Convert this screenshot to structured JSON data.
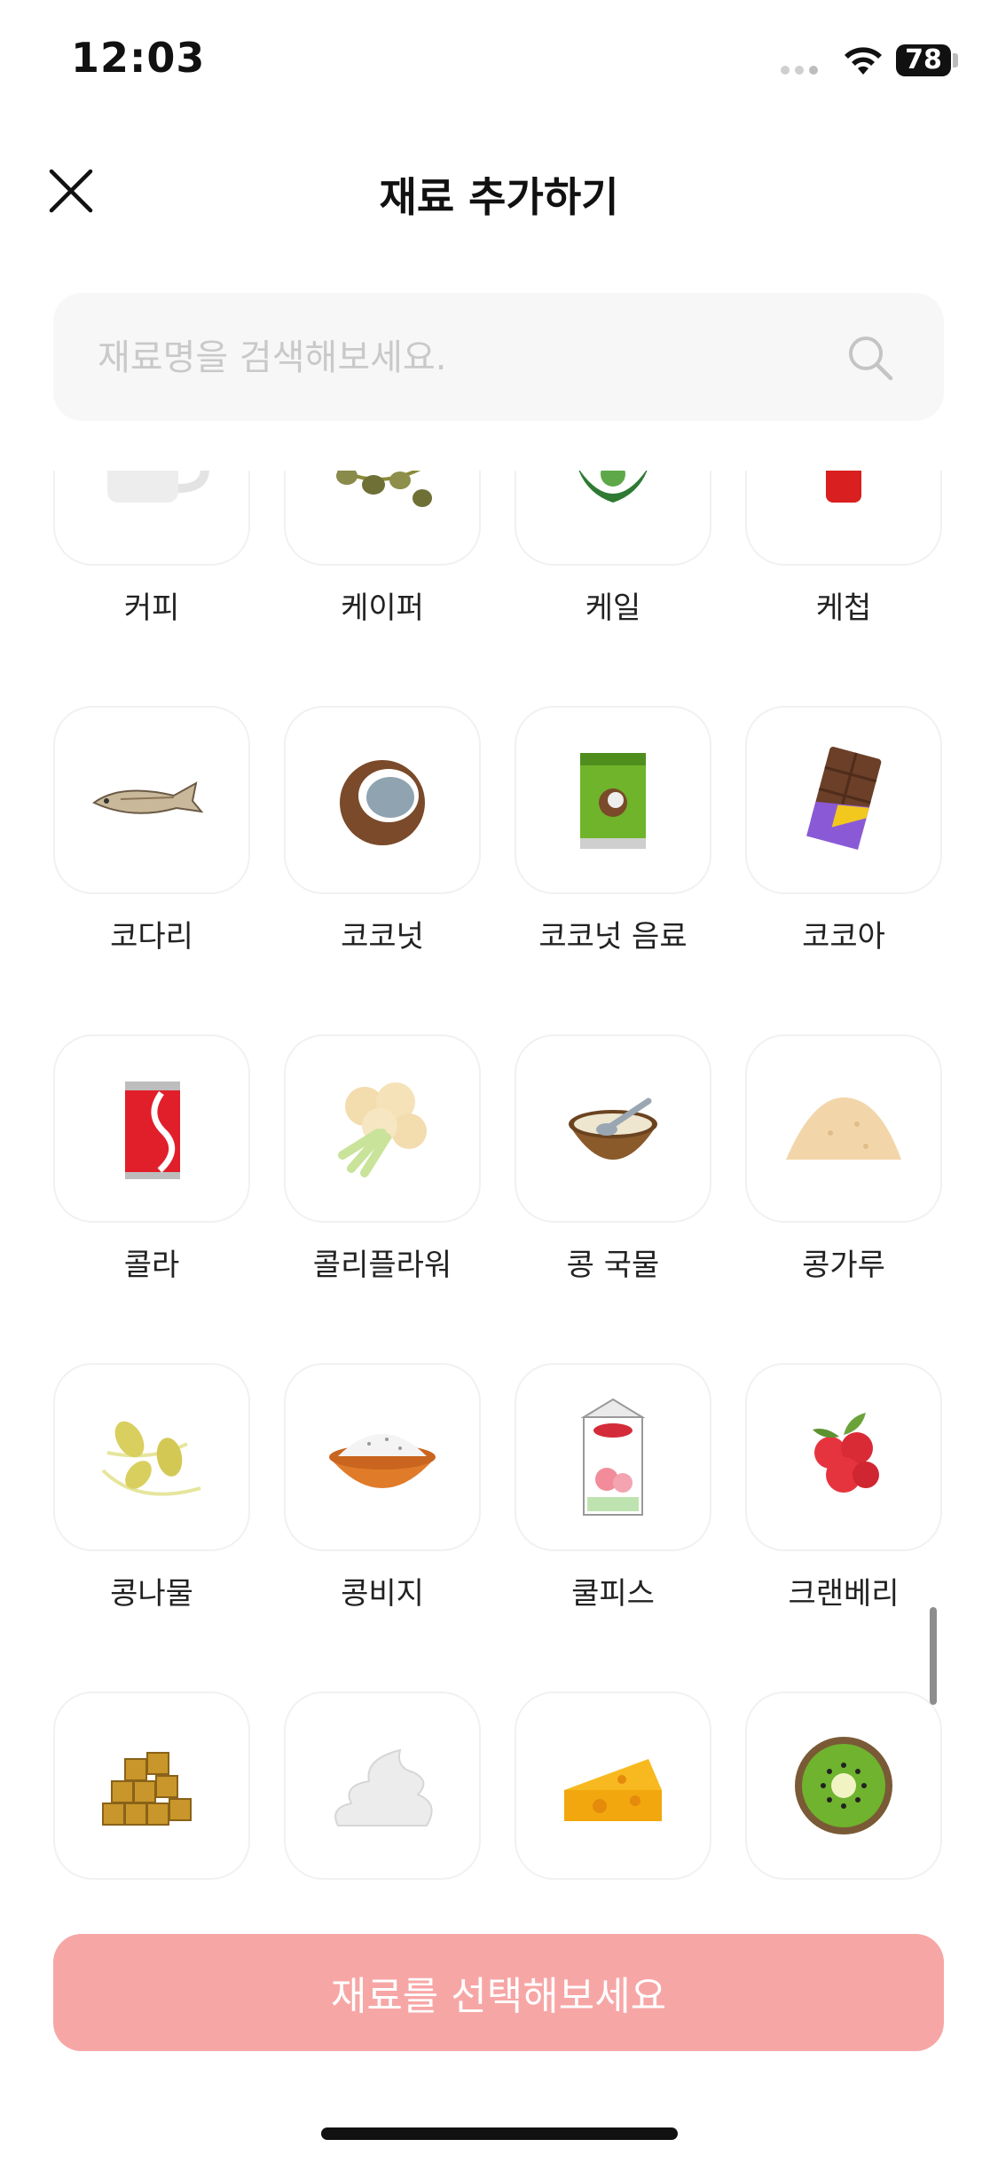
{
  "status_bar": {
    "time": "12:03",
    "battery": "78"
  },
  "header": {
    "title": "재료 추가하기"
  },
  "search": {
    "placeholder": "재료명을 검색해보세요."
  },
  "items": [
    {
      "label": "커피",
      "icon": "coffee-cup-icon"
    },
    {
      "label": "케이퍼",
      "icon": "capers-icon"
    },
    {
      "label": "케일",
      "icon": "kale-icon"
    },
    {
      "label": "케첩",
      "icon": "ketchup-icon"
    },
    {
      "label": "코다리",
      "icon": "dried-fish-icon"
    },
    {
      "label": "코코넛",
      "icon": "coconut-icon"
    },
    {
      "label": "코코넛 음료",
      "icon": "coconut-drink-icon"
    },
    {
      "label": "코코아",
      "icon": "chocolate-icon"
    },
    {
      "label": "콜라",
      "icon": "cola-can-icon"
    },
    {
      "label": "콜리플라워",
      "icon": "cauliflower-icon"
    },
    {
      "label": "콩 국물",
      "icon": "soup-bowl-icon"
    },
    {
      "label": "콩가루",
      "icon": "powder-pile-icon"
    },
    {
      "label": "콩나물",
      "icon": "bean-sprout-icon"
    },
    {
      "label": "콩비지",
      "icon": "bean-curd-bowl-icon"
    },
    {
      "label": "쿨피스",
      "icon": "juice-carton-icon"
    },
    {
      "label": "크랜베리",
      "icon": "cranberry-icon"
    },
    {
      "label": "",
      "icon": "sugar-cubes-icon"
    },
    {
      "label": "",
      "icon": "whipped-cream-icon"
    },
    {
      "label": "",
      "icon": "cheese-icon"
    },
    {
      "label": "",
      "icon": "kiwi-icon"
    }
  ],
  "cta": {
    "label": "재료를 선택해보세요",
    "color": "#f7a6a6"
  }
}
